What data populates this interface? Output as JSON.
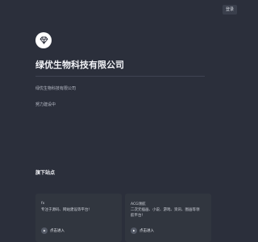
{
  "header": {
    "login_label": "登录"
  },
  "site": {
    "title": "绿优生物科技有限公司",
    "subtitle": "绿优生物科技有限公司",
    "status": "努力建设中"
  },
  "section": {
    "title": "旗下站点"
  },
  "cards": [
    {
      "name": "fx",
      "desc": "专注于源码、网站建设等平台!",
      "visit_label": "点击进入"
    },
    {
      "name": "ACG领航",
      "desc": "二次元插画、小说、游戏、资讯、图画等领航平台!",
      "visit_label": "点击进入"
    }
  ],
  "icons": {
    "logo": "diamond-icon",
    "visit": "play-icon"
  }
}
